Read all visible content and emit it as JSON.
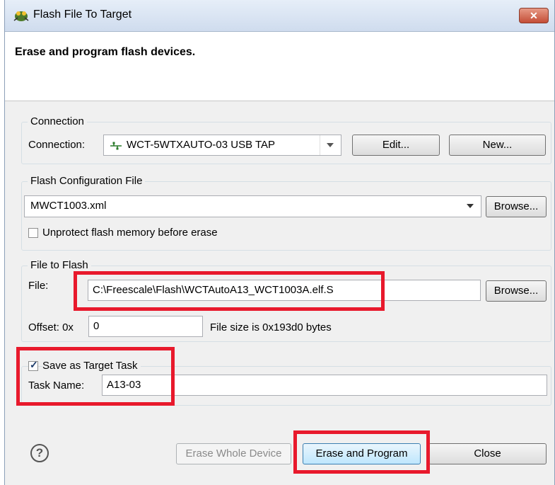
{
  "window": {
    "title": "Flash File To Target",
    "close_glyph": "✕"
  },
  "header": {
    "text": "Erase and program flash devices."
  },
  "connection": {
    "group_label": "Connection",
    "field_label": "Connection:",
    "value": "WCT-5WTXAUTO-03 USB TAP",
    "edit_label": "Edit...",
    "new_label": "New..."
  },
  "flash_config": {
    "group_label": "Flash Configuration File",
    "value": "MWCT1003.xml",
    "browse_label": "Browse...",
    "unprotect_label": "Unprotect flash memory before erase",
    "unprotect_checked": false
  },
  "file_to_flash": {
    "group_label": "File to Flash",
    "file_label": "File:",
    "file_value": "C:\\Freescale\\Flash\\WCTAutoA13_WCT1003A.elf.S",
    "browse_label": "Browse...",
    "offset_label": "Offset: 0x",
    "offset_value": "0",
    "size_text": "File size is 0x193d0 bytes"
  },
  "target_task": {
    "save_label": "Save as Target Task",
    "save_checked": true,
    "task_name_label": "Task Name:",
    "task_name_value": "A13-03"
  },
  "footer": {
    "help_glyph": "?",
    "erase_whole_label": "Erase Whole Device",
    "erase_program_label": "Erase and Program",
    "close_label": "Close"
  },
  "colors": {
    "highlight": "#e8192c"
  }
}
